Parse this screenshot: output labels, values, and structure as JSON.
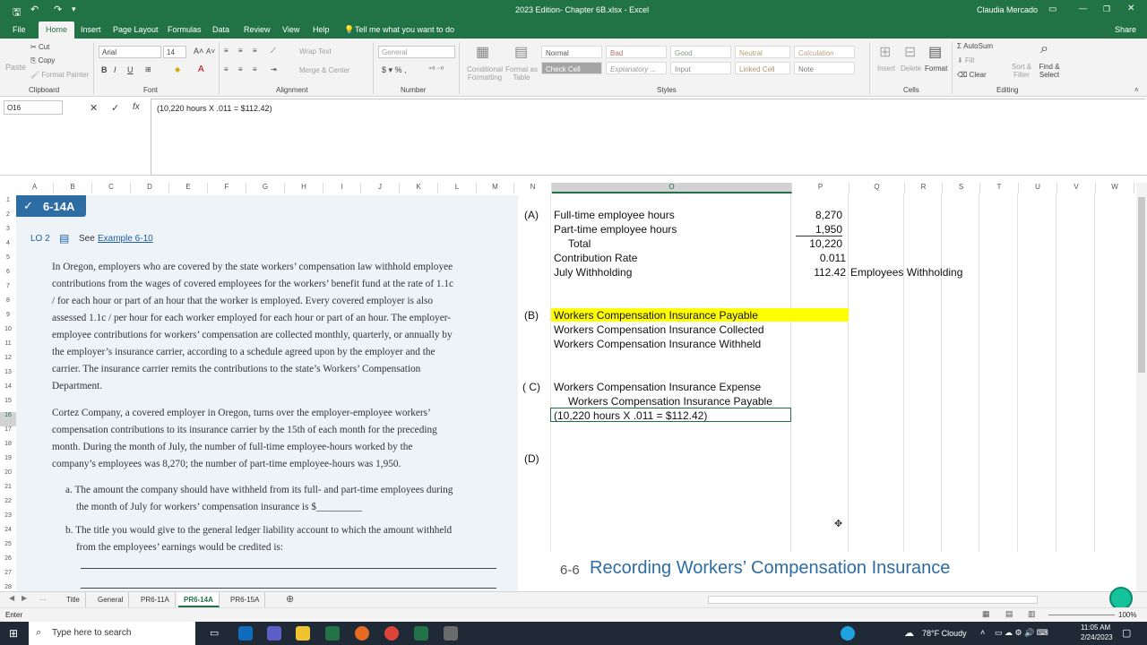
{
  "titlebar": {
    "filename": "2023 Edition- Chapter 6B.xlsx - Excel",
    "user": "Claudia Mercado"
  },
  "menu": {
    "tabs": [
      "File",
      "Home",
      "Insert",
      "Page Layout",
      "Formulas",
      "Data",
      "Review",
      "View",
      "Help"
    ],
    "tell_me": "Tell me what you want to do",
    "share": "Share"
  },
  "ribbon": {
    "clipboard": {
      "paste": "Paste",
      "cut": "Cut",
      "copy": "Copy",
      "format_painter": "Format Painter",
      "label": "Clipboard"
    },
    "font": {
      "name": "Arial",
      "size": "14",
      "label": "Font"
    },
    "alignment": {
      "wrap": "Wrap Text",
      "merge": "Merge & Center",
      "label": "Alignment"
    },
    "number": {
      "format": "General",
      "label": "Number"
    },
    "styles": {
      "cond": "Conditional Formatting",
      "table": "Format as Table",
      "normal": "Normal",
      "bad": "Bad",
      "good": "Good",
      "neutral": "Neutral",
      "calculation": "Calculation",
      "check_cell": "Check Cell",
      "explanatory": "Explanatory ...",
      "input": "Input",
      "linked_cell": "Linked Cell",
      "note": "Note",
      "label": "Styles"
    },
    "cells": {
      "insert": "Insert",
      "delete": "Delete",
      "format": "Format",
      "label": "Cells"
    },
    "editing": {
      "autosum": "AutoSum",
      "fill": "Fill",
      "clear": "Clear",
      "sort": "Sort & Filter",
      "find": "Find & Select",
      "label": "Editing"
    }
  },
  "formula_bar": {
    "name_box": "O16",
    "fx": "fx",
    "content": "(10,220 hours X .011 = $112.42)"
  },
  "columns": [
    "A",
    "B",
    "C",
    "D",
    "E",
    "F",
    "G",
    "H",
    "I",
    "J",
    "K",
    "L",
    "M",
    "N",
    "O",
    "P",
    "Q",
    "R",
    "S",
    "T",
    "U",
    "V",
    "W"
  ],
  "rows": [
    "1",
    "2",
    "3",
    "4",
    "5",
    "6",
    "7",
    "8",
    "9",
    "10",
    "11",
    "12",
    "13",
    "14",
    "15",
    "16",
    "17",
    "18",
    "19",
    "20",
    "21",
    "22",
    "23",
    "24",
    "25",
    "26",
    "27",
    "28"
  ],
  "book": {
    "problem_id": "6-14A",
    "lo": "LO 2",
    "see_prefix": "See",
    "see_link": "Example 6-10",
    "para1": [
      "In Oregon, employers who are covered by the state workers’ compensation law withhold employee",
      "contributions from the wages of covered employees for the workers’ benefit fund at the rate of 1.1c",
      "/ for each hour or part of an hour that the worker is employed. Every covered employer is also",
      "assessed 1.1c / per hour for each worker employed for each hour or part of an hour. The employer-",
      "employee contributions for workers’ compensation are collected monthly, quarterly, or annually by",
      "the employer’s insurance carrier, according to a schedule agreed upon by the employer and the",
      "carrier. The insurance carrier remits the contributions to the state’s Workers’ Compensation",
      "Department."
    ],
    "para2": [
      "Cortez Company, a covered employer in Oregon, turns over the employer-employee workers’",
      "compensation contributions to its insurance carrier by the 15th of each month for the preceding",
      "month. During the month of July, the number of full-time employee-hours worked by the",
      "company’s employees was 8,270; the number of part-time employee-hours was 1,950."
    ],
    "qa": [
      "a. The amount the company should have withheld from its full- and part-time employees during",
      "the month of July for workers’ compensation insurance is $_________"
    ],
    "qb": [
      "b. The title you would give to the general ledger liability account to which the amount withheld",
      "from the employees’ earnings would be credited is:"
    ]
  },
  "sheet": {
    "a_label": "(A)",
    "a_rows": [
      {
        "label": "Full-time employee hours",
        "value": "8,270",
        "indent": false
      },
      {
        "label": "Part-time employee hours",
        "value": "1,950",
        "indent": false
      },
      {
        "label": "Total",
        "value": "10,220",
        "indent": true
      },
      {
        "label": "Contribution Rate",
        "value": "0.011",
        "indent": false
      },
      {
        "label": "July Withholding",
        "value": "112.42",
        "indent": false
      }
    ],
    "employees_withholding": "Employees Withholding",
    "b_label": "(B)",
    "b_rows": [
      "Workers Compensation Insurance Payable",
      "Workers Compensation Insurance Collected",
      "Workers Compensation Insurance Withheld"
    ],
    "c_label": "( C)",
    "c_rows": [
      "Workers Compensation Insurance Expense",
      "Workers Compensation Insurance Payable",
      "(10,220 hours X .011 = $112.42)"
    ],
    "d_label": "(D)",
    "highlight_color": "#ffff00",
    "section_num": "6-6",
    "section_title": "Recording Workers’ Compensation Insurance"
  },
  "sheet_tabs": [
    "Title",
    "General",
    "PR6-11A",
    "PR6-14A",
    "PR6-15A"
  ],
  "active_tab": "PR6-14A",
  "status": {
    "mode": "Enter",
    "zoom": "100%"
  },
  "taskbar": {
    "search": "Type here to search",
    "weather": "78°F  Cloudy",
    "time": "11:05 AM",
    "date": "2/24/2023"
  },
  "colors": {
    "excel_green": "#217346",
    "taskbar": "#1f2a36",
    "link_blue": "#1a5fa8"
  }
}
